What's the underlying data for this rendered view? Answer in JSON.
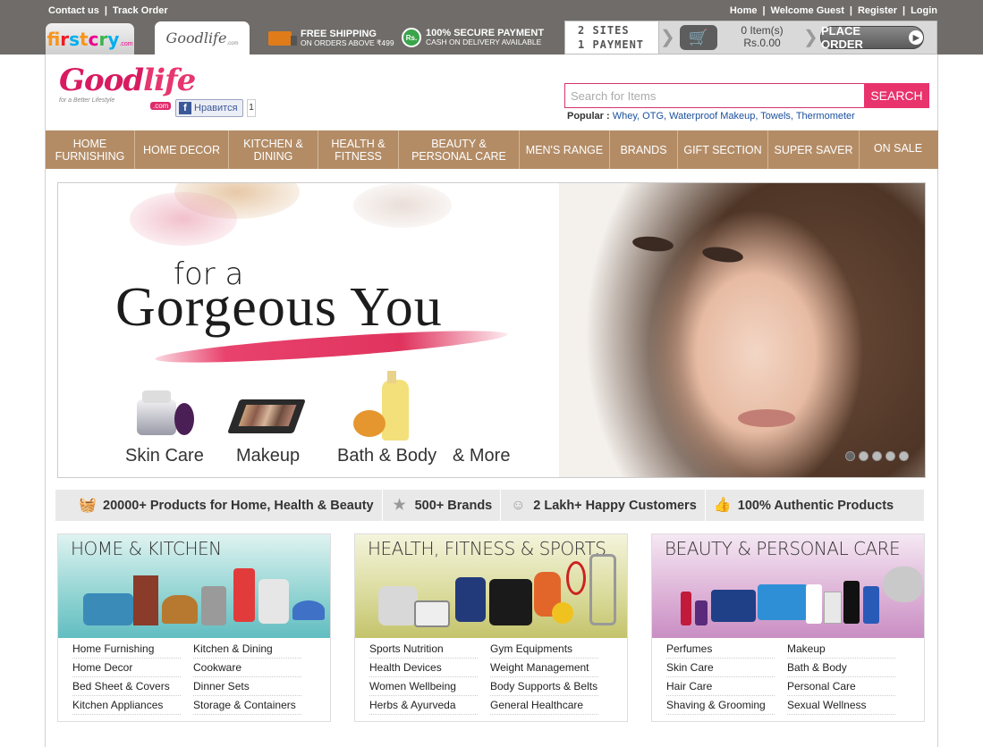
{
  "topbar": {
    "left_links": [
      "Contact us",
      "Track Order"
    ],
    "right_links": [
      "Home",
      "Welcome Guest",
      "Register",
      "Login"
    ],
    "tabs": {
      "firstcry": "firstcry",
      "firstcry_suffix": ".com",
      "goodlife": "Goodlife",
      "goodlife_suffix": ".com"
    },
    "promo_shipping": {
      "line1": "FREE SHIPPING",
      "line2": "ON ORDERS ABOVE ₹499"
    },
    "promo_payment": {
      "line1": "100% SECURE PAYMENT",
      "line2": "CASH ON DELIVERY AVAILABLE",
      "badge": "Rs."
    },
    "sites_line1": "2 SITES",
    "sites_line2": "1 PAYMENT",
    "cart_items": "0 Item(s)",
    "cart_total": "Rs.0.00",
    "place_order": "PLACE ORDER"
  },
  "logo": {
    "good": "Good",
    "life": "life",
    "tagline": "for a Better Lifestyle",
    "com": ".com"
  },
  "facebook": {
    "label": "Нравится",
    "count": "1"
  },
  "search": {
    "placeholder": "Search for Items",
    "button": "SEARCH"
  },
  "popular": {
    "label": "Popular :",
    "items": [
      "Whey",
      "OTG",
      "Waterproof Makeup",
      "Towels",
      "Thermometer"
    ]
  },
  "nav": [
    {
      "line1": "HOME",
      "line2": "FURNISHING"
    },
    {
      "line1": "HOME DECOR",
      "line2": ""
    },
    {
      "line1": "KITCHEN &",
      "line2": "DINING"
    },
    {
      "line1": "HEALTH &",
      "line2": "FITNESS"
    },
    {
      "line1": "BEAUTY &",
      "line2": "PERSONAL CARE"
    },
    {
      "line1": "MEN'S RANGE",
      "line2": ""
    },
    {
      "line1": "BRANDS",
      "line2": ""
    },
    {
      "line1": "GIFT SECTION",
      "line2": ""
    },
    {
      "line1": "SUPER SAVER",
      "line2": ""
    },
    {
      "line1": "ON SALE",
      "line2": ""
    }
  ],
  "banner": {
    "line1": "for a",
    "line2": "Gorgeous You",
    "products": [
      "Skin Care",
      "Makeup",
      "Bath & Body",
      "& More"
    ],
    "slide_count": 5,
    "active_slide": 1
  },
  "features": [
    {
      "icon": "basket-icon",
      "text": "20000+ Products for Home, Health & Beauty"
    },
    {
      "icon": "star-icon",
      "text": "500+ Brands"
    },
    {
      "icon": "smiley-icon",
      "text": "2 Lakh+ Happy Customers"
    },
    {
      "icon": "thumbs-up-icon",
      "text": "100% Authentic Products"
    }
  ],
  "categories": [
    {
      "title": "HOME & KITCHEN",
      "color": "#6cc3c6",
      "links": [
        "Home Furnishing",
        "Kitchen & Dining",
        "Home Decor",
        "Cookware",
        "Bed Sheet & Covers",
        "Dinner Sets",
        "Kitchen Appliances",
        "Storage & Containers"
      ]
    },
    {
      "title": "HEALTH, FITNESS & SPORTS",
      "color": "#c9c96a",
      "links": [
        "Sports Nutrition",
        "Gym Equipments",
        "Health Devices",
        "Weight Management",
        "Women Wellbeing",
        "Body Supports & Belts",
        "Herbs & Ayurveda",
        "General Healthcare"
      ]
    },
    {
      "title": "BEAUTY & PERSONAL CARE",
      "color": "#cc8fc6",
      "links": [
        "Perfumes",
        "Makeup",
        "Skin Care",
        "Bath & Body",
        "Hair Care",
        "Personal Care",
        "Shaving & Grooming",
        "Sexual Wellness"
      ]
    }
  ]
}
